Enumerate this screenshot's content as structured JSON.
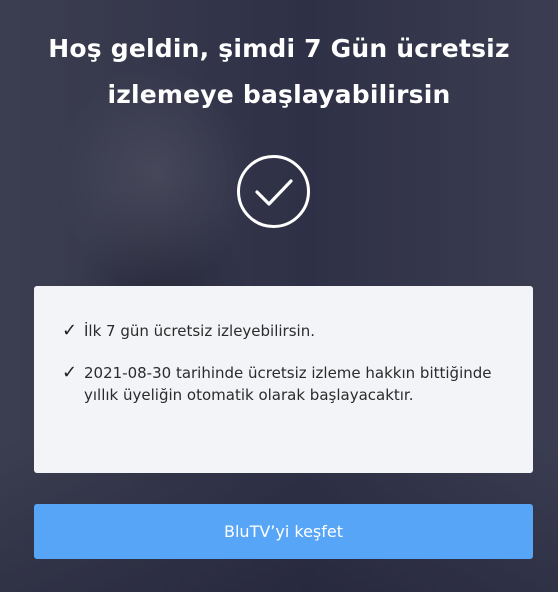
{
  "header": {
    "title_line1": "Hoş geldin, şimdi 7 Gün ücretsiz",
    "title_line2": "izlemeye başlayabilirsin"
  },
  "icons": {
    "success": "check-circle-icon",
    "bullet": "checkmark-icon"
  },
  "info": {
    "items": [
      {
        "tick": "✓",
        "text": "İlk 7 gün ücretsiz izleyebilirsin."
      },
      {
        "tick": "✓",
        "text": "2021-08-30 tarihinde ücretsiz izleme hakkın bittiğinde yıllık üyeliğin otomatik olarak başlayacaktır."
      }
    ]
  },
  "cta": {
    "label": "BluTV’yi keşfet"
  },
  "colors": {
    "button": "#56a5f6",
    "card": "#f3f4f8",
    "background": "#3a3b4f"
  }
}
